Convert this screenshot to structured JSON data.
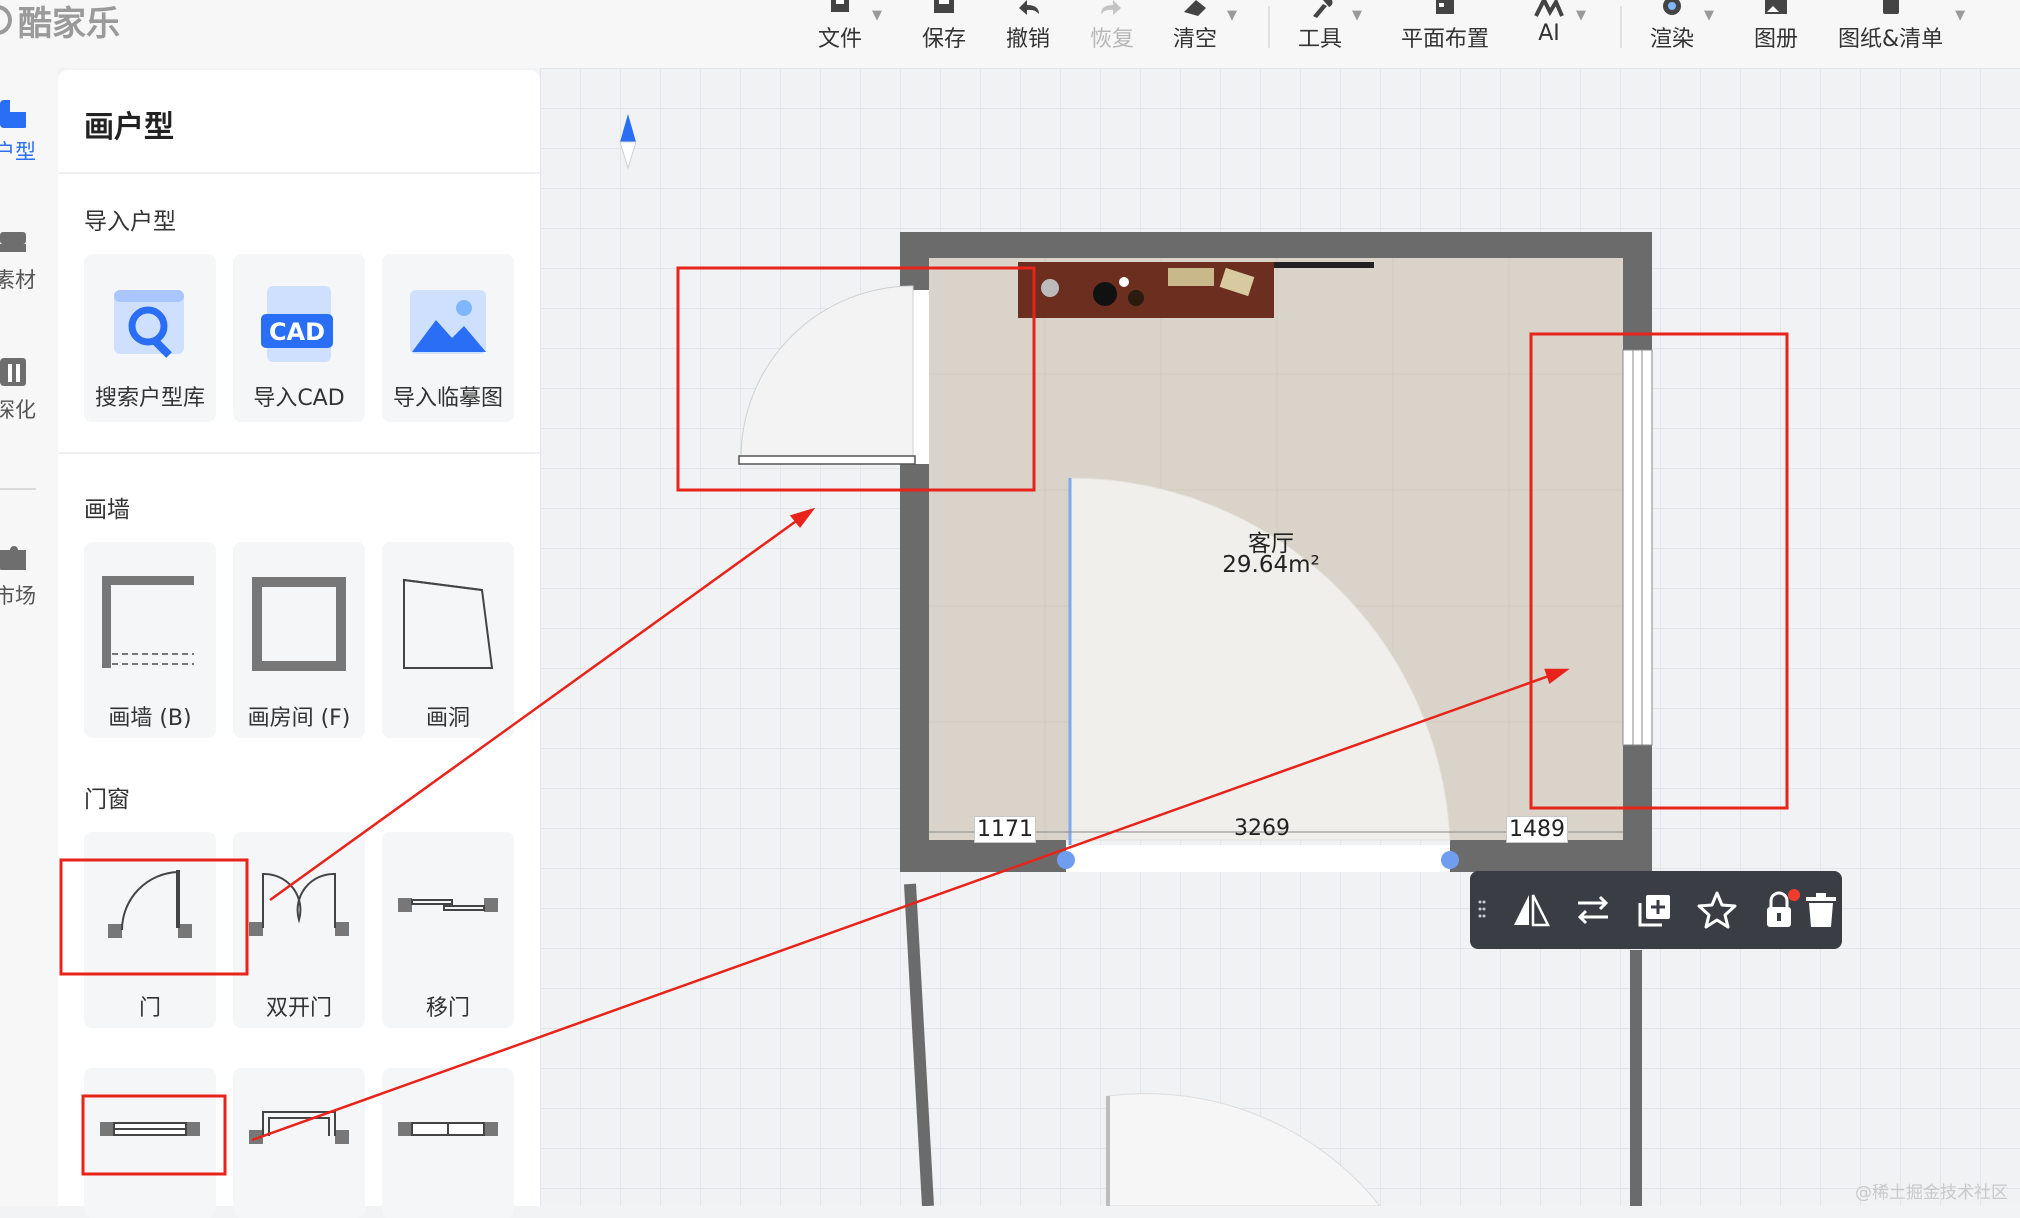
{
  "app": {
    "logo_text": "酷家乐"
  },
  "toolbar": {
    "file": "文件",
    "save": "保存",
    "undo": "撤销",
    "redo": "恢复",
    "clear": "清空",
    "tools": "工具",
    "layout": "平面布置",
    "ai": "AI",
    "render": "渲染",
    "album": "图册",
    "drawings": "图纸&清单"
  },
  "rail": {
    "items": [
      {
        "label": "户型",
        "icon": "floorplan-icon"
      },
      {
        "label": "素材",
        "icon": "sofa-icon"
      },
      {
        "label": "深化",
        "icon": "detail-icon"
      },
      {
        "label": "市场",
        "icon": "puzzle-icon"
      }
    ]
  },
  "panel": {
    "title": "画户型",
    "import": {
      "title": "导入户型",
      "items": [
        "搜索户型库",
        "导入CAD",
        "导入临摹图"
      ],
      "cad_badge": "CAD"
    },
    "walls": {
      "title": "画墙",
      "items": [
        "画墙 (B)",
        "画房间 (F)",
        "画洞"
      ]
    },
    "doors": {
      "title": "门窗",
      "items": [
        "门",
        "双开门",
        "移门"
      ]
    }
  },
  "canvas": {
    "room_name": "客厅",
    "room_area": "29.64m²",
    "dimensions": [
      "1171",
      "3269",
      "1489"
    ]
  },
  "context_toolbar": {
    "buttons": [
      "mirror-icon",
      "swap-icon",
      "duplicate-icon",
      "star-icon",
      "lock-icon",
      "delete-icon"
    ]
  },
  "watermark": "@稀土掘金技术社区",
  "colors": {
    "accent": "#2a6ef5",
    "annotation": "#e8231a",
    "wall": "#6b6b6b"
  }
}
